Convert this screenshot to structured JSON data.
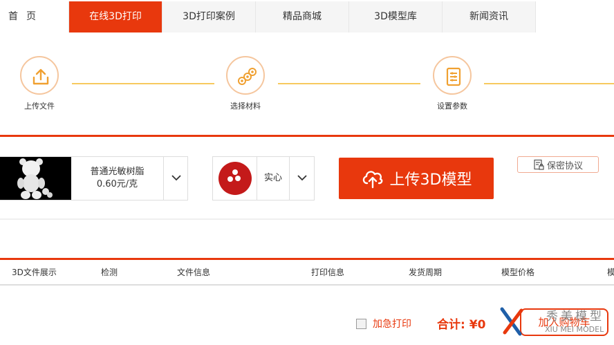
{
  "nav": {
    "tabs": [
      {
        "label": "首页"
      },
      {
        "label": "在线3D打印"
      },
      {
        "label": "3D打印案例"
      },
      {
        "label": "精品商城"
      },
      {
        "label": "3D模型库"
      },
      {
        "label": "新闻资讯"
      }
    ],
    "active_index": 1
  },
  "steps": [
    {
      "label": "上传文件",
      "icon": "upload-icon"
    },
    {
      "label": "选择材料",
      "icon": "material-rolls-icon"
    },
    {
      "label": "设置参数",
      "icon": "settings-list-icon"
    }
  ],
  "config": {
    "material": {
      "name": "普通光敏树脂",
      "price": "0.60元/克"
    },
    "fill": {
      "label": "实心"
    },
    "upload_button": "上传3D模型",
    "privacy_button": "保密协议"
  },
  "table": {
    "columns": [
      "3D文件展示",
      "检测",
      "文件信息",
      "打印信息",
      "发货周期",
      "模型价格",
      "模"
    ]
  },
  "footer": {
    "rush_label": "加急打印",
    "total_label": "合计:",
    "total_value": "¥0",
    "cart_button": "加入购物车"
  },
  "watermark": {
    "cn": "秀美模型",
    "en": "XIU MEI MODEL"
  },
  "colors": {
    "accent": "#e8380d",
    "step_line": "#f7c95e",
    "step_circle": "#f5c69e"
  }
}
